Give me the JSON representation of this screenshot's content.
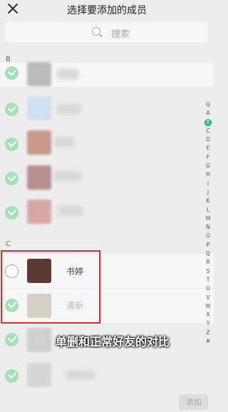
{
  "header": {
    "title": "选择要添加的成员"
  },
  "search": {
    "placeholder": "搜索"
  },
  "sections": [
    {
      "letter": "B"
    },
    {
      "letter": "C"
    }
  ],
  "contacts_c": [
    {
      "name": "书婷",
      "selected": false
    },
    {
      "name": "清新",
      "selected": true
    }
  ],
  "index_bar": [
    "Q",
    "A",
    "B",
    "C",
    "D",
    "E",
    "F",
    "G",
    "H",
    "I",
    "J",
    "K",
    "L",
    "M",
    "N",
    "O",
    "P",
    "Q",
    "R",
    "S",
    "T",
    "U",
    "V",
    "W",
    "X",
    "Y",
    "Z",
    "#"
  ],
  "index_active": "B",
  "caption": "单删和正常好友的对比",
  "footer": {
    "add_label": "添加"
  },
  "colors": {
    "accent": "#07c160",
    "check_disabled": "#a6e0b7",
    "highlight": "#e02b2b"
  }
}
